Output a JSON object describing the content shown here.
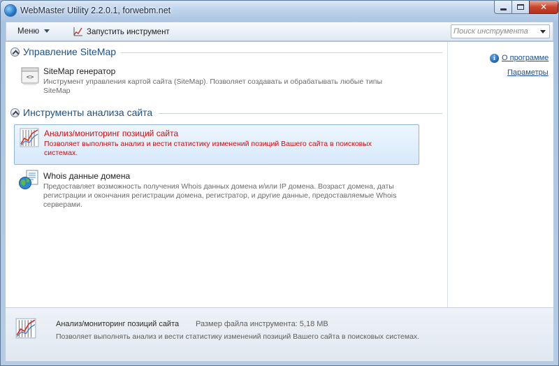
{
  "window": {
    "title": "WebMaster Utility 2.2.0.1, forwebm.net",
    "controls": {
      "minimize_icon": "minimize-icon",
      "maximize_icon": "maximize-icon",
      "close_icon": "close-icon",
      "close_glyph": "✕"
    }
  },
  "toolbar": {
    "menu_label": "Меню",
    "run_label": "Запустить инструмент",
    "search_placeholder": "Поиск инструмента"
  },
  "sections": [
    {
      "title": "Управление SiteMap",
      "tools": [
        {
          "name": "SiteMap генератор",
          "icon": "sitemap-code-icon",
          "description": "Инструмент управления картой сайта (SiteMap). Позволяет создавать и обрабатывать любые типы SiteMap"
        }
      ]
    },
    {
      "title": "Инструменты анализа сайта",
      "tools": [
        {
          "name": "Анализ/мониторинг позиций сайта",
          "icon": "position-chart-icon",
          "selected": true,
          "description": "Позволяет выполнять анализ и вести статистику изменений позиций Вашего сайта в поисковых системах."
        },
        {
          "name": "Whois данные домена",
          "icon": "whois-globe-icon",
          "description": "Предоставляет возможность получения Whois данных домена и/или IP домена. Возраст домена, даты регистрации и окончания регистрации домена, регистратор, и другие данные, предоставляемые Whois серверами."
        }
      ]
    }
  ],
  "sidebar": {
    "about_label": "О программе",
    "settings_label": "Параметры"
  },
  "detail": {
    "name": "Анализ/мониторинг позиций сайта",
    "size": "Размер файла инструмента: 5,18 MB",
    "description": "Позволяет выполнять анализ и вести статистику изменений позиций Вашего сайта в поисковых системах."
  },
  "colors": {
    "selected_text": "#d60a0a",
    "section_title": "#1e4f86",
    "link": "#1b4f8d"
  }
}
